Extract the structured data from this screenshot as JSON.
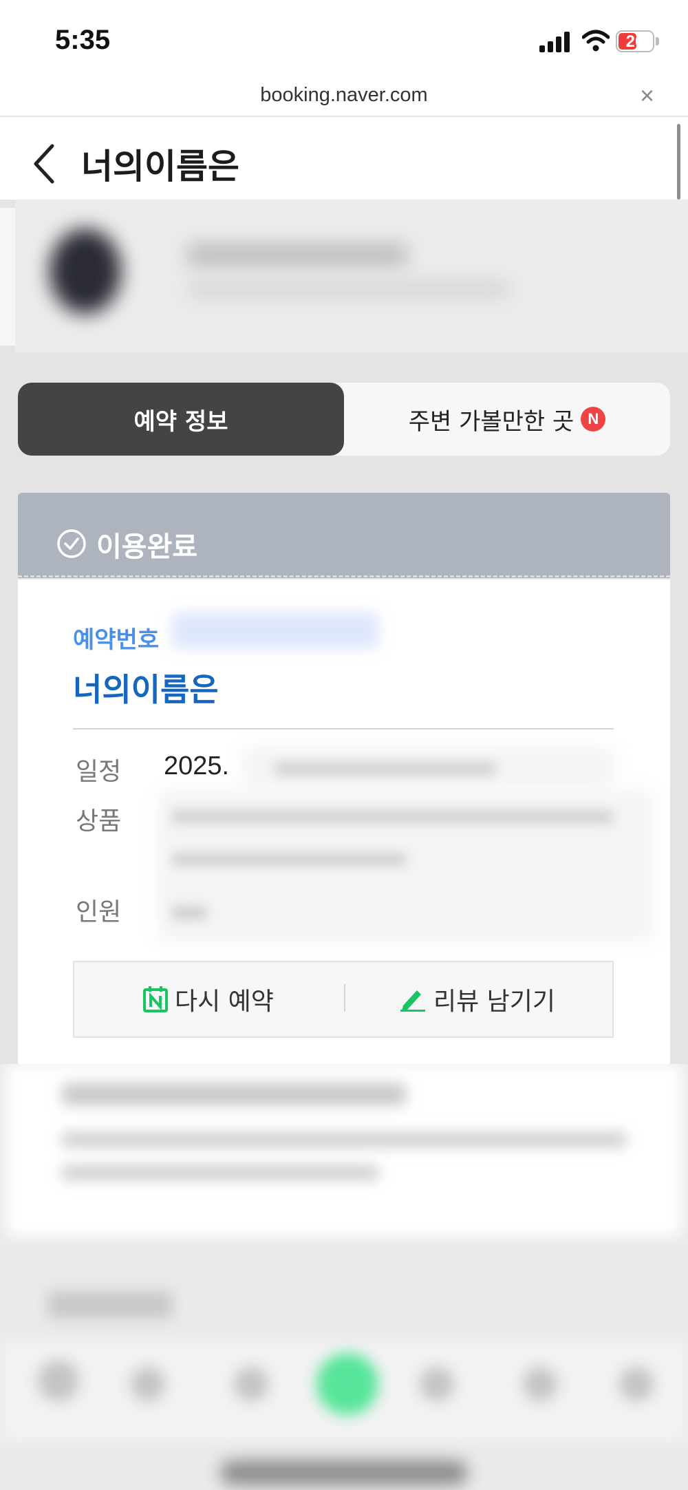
{
  "status_bar": {
    "time": "5:35",
    "battery": "20"
  },
  "browser": {
    "url": "booking.naver.com",
    "close": "×"
  },
  "header": {
    "title": "너의이름은"
  },
  "tabs": [
    {
      "label": "예약 정보",
      "active": true
    },
    {
      "label": "주변 가볼만한 곳",
      "badge": "N"
    }
  ],
  "status": {
    "label": "이용완료"
  },
  "reservation": {
    "number_label": "예약번호",
    "title": "너의이름은",
    "rows": [
      {
        "label": "일정",
        "value": "2025."
      },
      {
        "label": "상품",
        "value": ""
      },
      {
        "label": "인원",
        "value": ""
      }
    ]
  },
  "actions": {
    "rebook": "다시 예약",
    "review": "리뷰 남기기"
  },
  "colors": {
    "accent_blue": "#1666c0",
    "label_blue": "#4a8fe8",
    "naver_green": "#19c463",
    "status_gray": "#adb4bd",
    "badge_red": "#f04343"
  }
}
